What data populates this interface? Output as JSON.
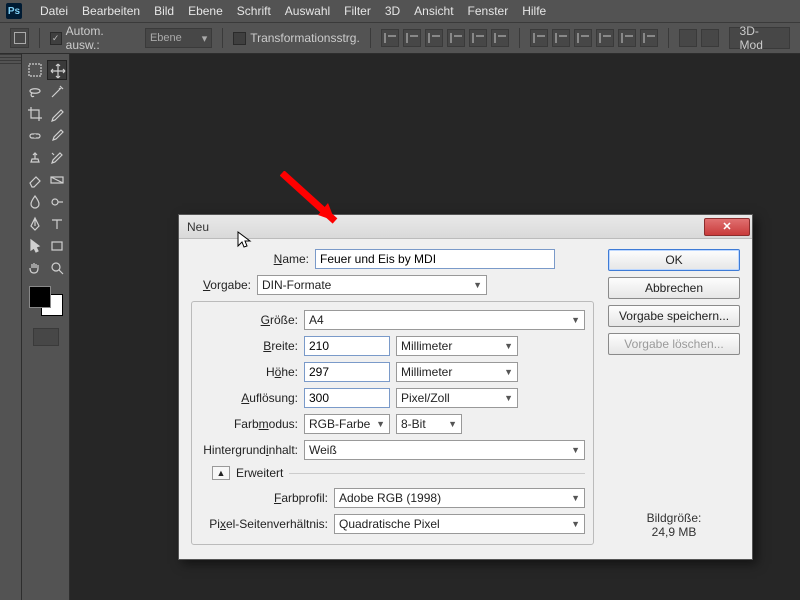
{
  "menubar": {
    "logo": "Ps",
    "items": [
      "Datei",
      "Bearbeiten",
      "Bild",
      "Ebene",
      "Schrift",
      "Auswahl",
      "Filter",
      "3D",
      "Ansicht",
      "Fenster",
      "Hilfe"
    ]
  },
  "optionsbar": {
    "auto_select_label": "Autom. ausw.:",
    "auto_select_checked": true,
    "target": "Ebene",
    "transform_label": "Transformationsstrg.",
    "transform_checked": false,
    "right_tab": "3D-Mod"
  },
  "dialog": {
    "title": "Neu",
    "labels": {
      "name": "Name:",
      "vorgabe": "Vorgabe:",
      "groesse": "Größe:",
      "breite": "Breite:",
      "hoehe": "Höhe:",
      "aufloesung": "Auflösung:",
      "farbmodus": "Farbmodus:",
      "hginhalt": "Hintergrundinhalt:",
      "erweitert": "Erweitert",
      "farbprofil": "Farbprofil:",
      "pixelsv": "Pixel-Seitenverhältnis:"
    },
    "values": {
      "name": "Feuer und Eis by MDI",
      "vorgabe": "DIN-Formate",
      "groesse": "A4",
      "breite": "210",
      "breite_unit": "Millimeter",
      "hoehe": "297",
      "hoehe_unit": "Millimeter",
      "aufloesung": "300",
      "aufloesung_unit": "Pixel/Zoll",
      "farbmodus": "RGB-Farbe",
      "farbtiefe": "8-Bit",
      "hginhalt": "Weiß",
      "farbprofil": "Adobe RGB (1998)",
      "pixelsv": "Quadratische Pixel"
    },
    "buttons": {
      "ok": "OK",
      "cancel": "Abbrechen",
      "save_preset": "Vorgabe speichern...",
      "delete_preset": "Vorgabe löschen..."
    },
    "info": {
      "label": "Bildgröße:",
      "value": "24,9 MB"
    }
  }
}
